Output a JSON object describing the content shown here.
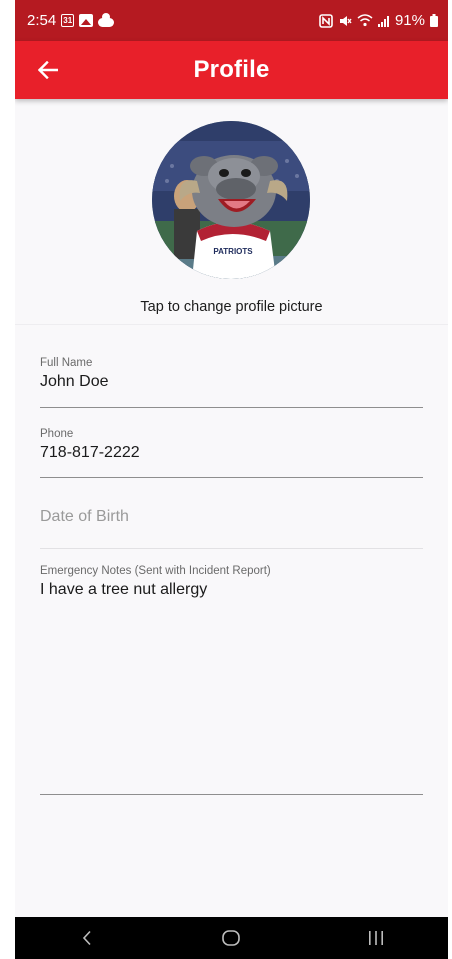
{
  "status_bar": {
    "time": "2:54",
    "calendar_day": "31",
    "battery": "91%"
  },
  "app_bar": {
    "title": "Profile",
    "back_icon": "arrow-left-icon"
  },
  "avatar": {
    "caption": "Tap to change profile picture",
    "jersey_text": "PATRIOTS"
  },
  "form": {
    "full_name": {
      "label": "Full Name",
      "value": "John Doe"
    },
    "phone": {
      "label": "Phone",
      "value": "718-817-2222"
    },
    "date_of_birth": {
      "placeholder": "Date of Birth"
    },
    "emergency_notes": {
      "label": "Emergency Notes (Sent with Incident Report)",
      "value": "I have a tree nut allergy"
    }
  },
  "nav_bar": {
    "back": "back-icon",
    "home": "home-icon",
    "recents": "recents-icon"
  },
  "colors": {
    "status_bar": "#b51a21",
    "app_bar": "#e8202a",
    "background": "#f9f8fa"
  }
}
